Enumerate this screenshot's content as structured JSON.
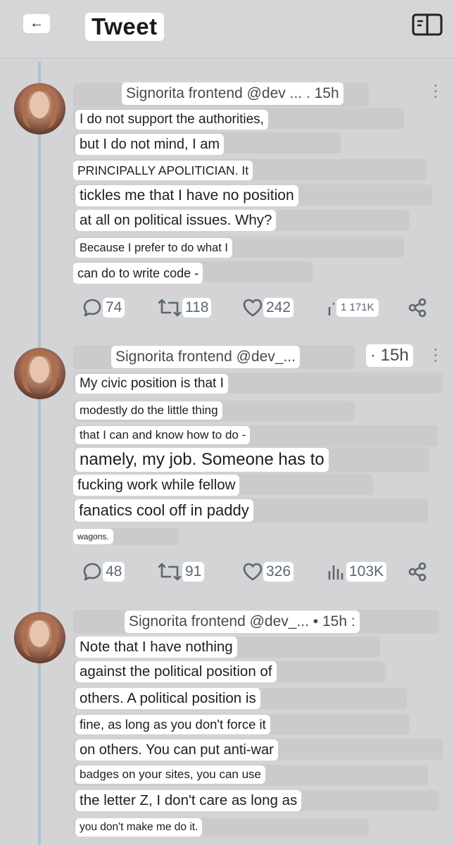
{
  "header": {
    "back_label": "←",
    "title": "Tweet",
    "reader_icon": "book-icon"
  },
  "tweets": [
    {
      "meta": "Signorita frontend @dev ... . 15h",
      "more_icon": "⋮",
      "lines": [
        "I do not support the authorities,",
        "but I do not mind, I am",
        "PRINCIPALLY APOLITICIAN. It",
        "tickles me that I have no position",
        "at all on political issues. Why?",
        "Because I prefer to do what I",
        "can do to write code -"
      ],
      "stats": {
        "replies": "74",
        "retweets": "118",
        "likes": "242",
        "views": "1 171K"
      }
    },
    {
      "meta": "Signorita frontend @dev_...",
      "time": "· 15h",
      "more_icon": "⋮",
      "lines": [
        "My civic position is that I",
        "modestly do the little thing",
        "that I can and know how to do -",
        "namely, my job. Someone has to",
        "fucking work while fellow",
        "fanatics cool off in paddy",
        "wagons."
      ],
      "stats": {
        "replies": "48",
        "retweets": "91",
        "likes": "326",
        "views": "103K"
      }
    },
    {
      "meta": "Signorita frontend @dev_... • 15h :",
      "lines": [
        "Note that I have nothing",
        "against the political position of",
        "others. A political position is",
        "fine, as long as you don't force it",
        "on others. You can put anti-war",
        "badges on your sites, you can use",
        "the letter Z, I don't care as long as",
        "you don't make me do it."
      ]
    }
  ]
}
